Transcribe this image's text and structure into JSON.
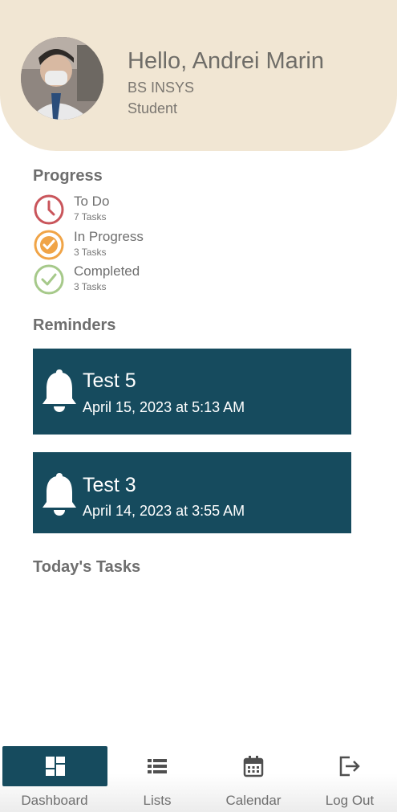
{
  "profile": {
    "greeting": "Hello, Andrei Marin",
    "program": "BS INSYS",
    "role": "Student"
  },
  "progress": {
    "title": "Progress",
    "items": [
      {
        "label": "To Do",
        "count": "7 Tasks",
        "icon": "clock-icon",
        "color": "#c9555b"
      },
      {
        "label": "In Progress",
        "count": "3 Tasks",
        "icon": "progress-icon",
        "color": "#f0a447"
      },
      {
        "label": "Completed",
        "count": "3 Tasks",
        "icon": "check-circle-icon",
        "color": "#a6c98a"
      }
    ]
  },
  "reminders": {
    "title": "Reminders",
    "items": [
      {
        "title": "Test 5",
        "date": "April 15, 2023 at 5:13 AM"
      },
      {
        "title": "Test 3",
        "date": "April 14, 2023 at 3:55 AM"
      }
    ]
  },
  "today": {
    "title": "Today's Tasks"
  },
  "nav": {
    "items": [
      {
        "label": "Dashboard",
        "icon": "dashboard-icon",
        "active": true
      },
      {
        "label": "Lists",
        "icon": "list-icon",
        "active": false
      },
      {
        "label": "Calendar",
        "icon": "calendar-icon",
        "active": false
      },
      {
        "label": "Log Out",
        "icon": "logout-icon",
        "active": false
      }
    ]
  },
  "colors": {
    "header_bg": "#f1e6d3",
    "accent": "#164b5e"
  }
}
